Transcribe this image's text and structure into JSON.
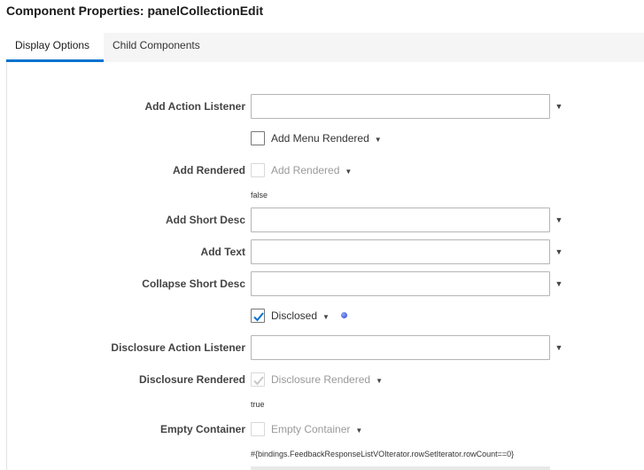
{
  "header": {
    "title": "Component Properties: panelCollectionEdit"
  },
  "tabs": [
    {
      "label": "Display Options",
      "active": true
    },
    {
      "label": "Child Components",
      "active": false
    }
  ],
  "form": {
    "add_action_listener": {
      "label": "Add Action Listener",
      "value": ""
    },
    "add_menu_rendered": {
      "label": "Add Menu Rendered",
      "checked": false
    },
    "add_rendered": {
      "label": "Add Rendered",
      "checkbox_label": "Add Rendered",
      "checked": false,
      "hint": "false"
    },
    "add_short_desc": {
      "label": "Add Short Desc",
      "value": ""
    },
    "add_text": {
      "label": "Add Text",
      "value": ""
    },
    "collapse_short_desc": {
      "label": "Collapse Short Desc",
      "value": ""
    },
    "disclosed": {
      "label": "Disclosed",
      "checked": true
    },
    "disclosure_action_listener": {
      "label": "Disclosure Action Listener",
      "value": ""
    },
    "disclosure_rendered": {
      "label": "Disclosure Rendered",
      "checkbox_label": "Disclosure Rendered",
      "checked": true,
      "hint": "true"
    },
    "empty_container": {
      "label": "Empty Container",
      "checkbox_label": "Empty Container",
      "checked": false,
      "hint": "#{bindings.FeedbackResponseListVOIterator.rowSetIterator.rowCount==0}"
    }
  },
  "icons": {
    "dropdown": "chevron-down-icon",
    "checkmark": "checkmark-icon",
    "status_dot": "status-dot-icon"
  },
  "colors": {
    "accent": "#0572ce",
    "check": "#0572ce",
    "dot": "#3b55d6"
  }
}
